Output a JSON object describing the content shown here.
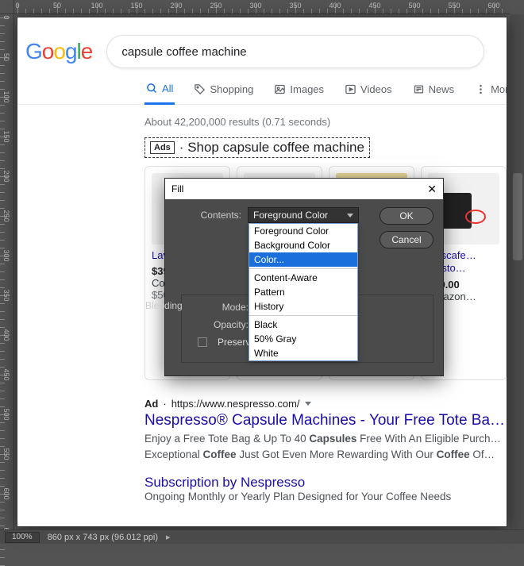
{
  "editor": {
    "status_zoom": "100%",
    "status_info": "860 px x 743 px (96.012 ppi)",
    "ruler_h_labels": [
      "0",
      "50",
      "100",
      "150",
      "200",
      "250",
      "300",
      "350",
      "400",
      "450",
      "500",
      "550",
      "600"
    ],
    "ruler_v_labels": [
      "0",
      "50",
      "100",
      "150",
      "200",
      "250",
      "300",
      "350",
      "400",
      "450",
      "500",
      "550",
      "600",
      "650"
    ]
  },
  "google": {
    "logo_letters": [
      "G",
      "o",
      "o",
      "g",
      "l",
      "e"
    ],
    "search_query": "capsule coffee machine",
    "tabs": {
      "all": "All",
      "shopping": "Shopping",
      "images": "Images",
      "videos": "Videos",
      "news": "News",
      "more": "More"
    },
    "result_stats": "About 42,200,000 results (0.71 seconds)",
    "ads_label": "Ads",
    "ads_title_sep": "·",
    "ads_title": "Shop capsule coffee machine",
    "cards": [
      {
        "title": "Lava… Mod…",
        "price": "$39.…",
        "store": "Cole…",
        "extra": "$50 …"
      },
      {
        "title": "",
        "price": "",
        "store": "",
        "extra": ""
      },
      {
        "title": "",
        "price": "",
        "store": "",
        "extra": ""
      },
      {
        "title": "Nescafe… Gusto…",
        "price": "$89.00",
        "store": "Amazon…",
        "extra": ""
      }
    ],
    "text_ad": {
      "badge": "Ad",
      "sep": "·",
      "url": "https://www.nespresso.com/",
      "title": "Nespresso® Capsule Machines - Your Free Tote Ba…",
      "desc_before1": "Enjoy a Free Tote Bag & Up To 40 ",
      "bold1": "Capsules",
      "desc_mid": " Free With An Eligible Purch… Exceptional ",
      "bold2": "Coffee",
      "desc_mid2": " Just Got Even More Rewarding With Our ",
      "bold3": "Coffee",
      "desc_after": " Of…",
      "sublink": "Subscription by Nespresso",
      "subdesc": "Ongoing Monthly or Yearly Plan Designed for Your Coffee Needs"
    }
  },
  "fill_dialog": {
    "title": "Fill",
    "contents_label": "Contents:",
    "contents_value": "Foreground Color",
    "ok": "OK",
    "cancel": "Cancel",
    "blending_label": "Blending",
    "mode_label": "Mode:",
    "opacity_label": "Opacity:",
    "preserve_label": "Preserve Trans…",
    "options": {
      "g1": [
        "Foreground Color",
        "Background Color",
        "Color..."
      ],
      "g2": [
        "Content-Aware",
        "Pattern",
        "History"
      ],
      "g3": [
        "Black",
        "50% Gray",
        "White"
      ]
    },
    "selected_option": "Color..."
  }
}
